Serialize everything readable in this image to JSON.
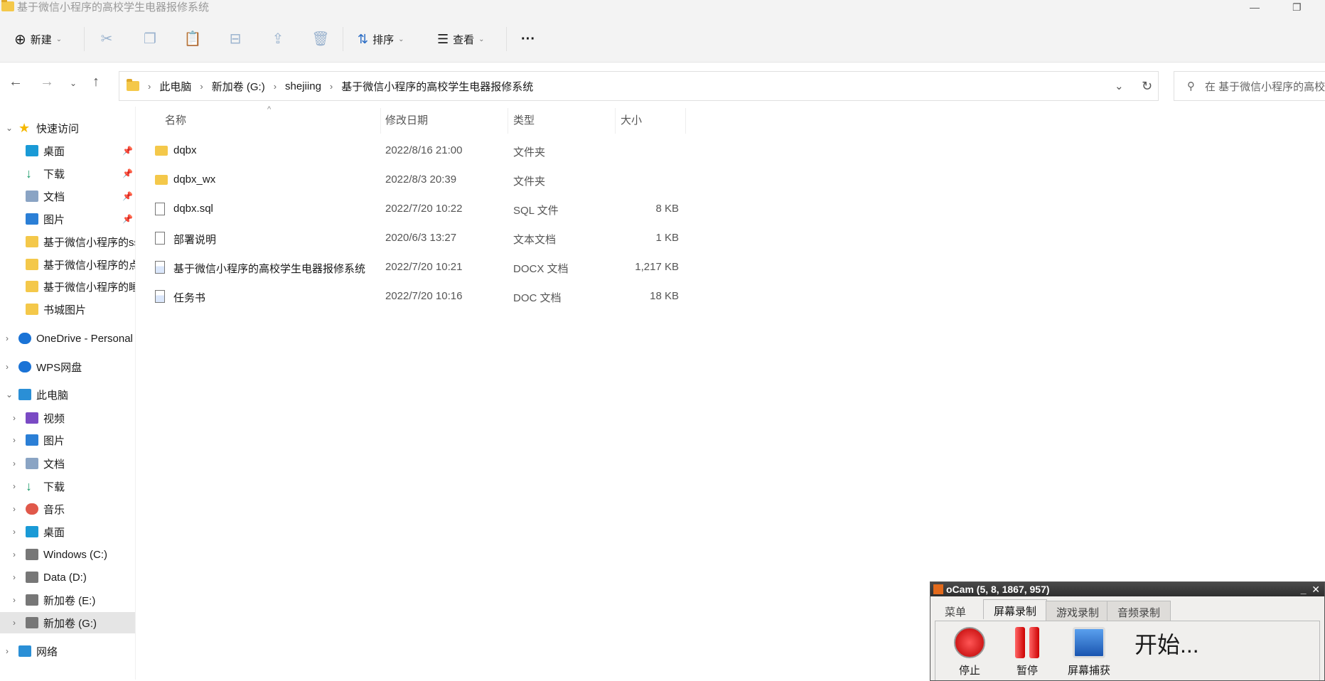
{
  "window": {
    "title": "基于微信小程序的高校学生电器报修系统"
  },
  "toolbar": {
    "new_label": "新建",
    "sort_label": "排序",
    "view_label": "查看",
    "more": "···"
  },
  "address": {
    "crumbs": [
      "此电脑",
      "新加卷 (G:)",
      "shejiing",
      "基于微信小程序的高校学生电器报修系统"
    ],
    "search_placeholder": "在 基于微信小程序的高校学生电器报修系统 中搜索"
  },
  "sidebar": {
    "items": [
      {
        "label": "快速访问",
        "level": 0,
        "icon": "star-icon",
        "chevron": "expanded"
      },
      {
        "label": "桌面",
        "level": 1,
        "icon": "desktop-icon",
        "pinned": true
      },
      {
        "label": "下载",
        "level": 1,
        "icon": "download-icon",
        "pinned": true
      },
      {
        "label": "文档",
        "level": 1,
        "icon": "documents-icon",
        "pinned": true
      },
      {
        "label": "图片",
        "level": 1,
        "icon": "pictures-icon",
        "pinned": true
      },
      {
        "label": "基于微信小程序的ssm",
        "level": 1,
        "icon": "folder-icon"
      },
      {
        "label": "基于微信小程序的点",
        "level": 1,
        "icon": "folder-icon"
      },
      {
        "label": "基于微信小程序的睡",
        "level": 1,
        "icon": "folder-icon"
      },
      {
        "label": "书城图片",
        "level": 1,
        "icon": "folder-icon"
      },
      {
        "label": "OneDrive - Personal",
        "level": 0,
        "icon": "cloud-icon",
        "chevron": "collapsed"
      },
      {
        "label": "WPS网盘",
        "level": 0,
        "icon": "cloud-icon",
        "chevron": "collapsed"
      },
      {
        "label": "此电脑",
        "level": 0,
        "icon": "computer-icon",
        "chevron": "expanded"
      },
      {
        "label": "视频",
        "level": 1,
        "icon": "videos-icon",
        "chevron": "collapsed"
      },
      {
        "label": "图片",
        "level": 1,
        "icon": "pictures-icon",
        "chevron": "collapsed"
      },
      {
        "label": "文档",
        "level": 1,
        "icon": "documents-icon",
        "chevron": "collapsed"
      },
      {
        "label": "下载",
        "level": 1,
        "icon": "download-icon",
        "chevron": "collapsed"
      },
      {
        "label": "音乐",
        "level": 1,
        "icon": "music-icon",
        "chevron": "collapsed"
      },
      {
        "label": "桌面",
        "level": 1,
        "icon": "desktop-icon",
        "chevron": "collapsed"
      },
      {
        "label": "Windows (C:)",
        "level": 1,
        "icon": "drive-icon",
        "chevron": "collapsed"
      },
      {
        "label": "Data (D:)",
        "level": 1,
        "icon": "drive-icon",
        "chevron": "collapsed"
      },
      {
        "label": "新加卷 (E:)",
        "level": 1,
        "icon": "drive-icon",
        "chevron": "collapsed"
      },
      {
        "label": "新加卷 (G:)",
        "level": 1,
        "icon": "drive-icon",
        "chevron": "collapsed",
        "selected": true
      },
      {
        "label": "网络",
        "level": 0,
        "icon": "network-icon",
        "chevron": "collapsed"
      }
    ]
  },
  "columns": {
    "name": "名称",
    "date": "修改日期",
    "type": "类型",
    "size": "大小"
  },
  "files": [
    {
      "name": "dqbx",
      "date": "2022/8/16 21:00",
      "type": "文件夹",
      "size": "",
      "icon": "folder-icon"
    },
    {
      "name": "dqbx_wx",
      "date": "2022/8/3 20:39",
      "type": "文件夹",
      "size": "",
      "icon": "folder-icon"
    },
    {
      "name": "dqbx.sql",
      "date": "2022/7/20 10:22",
      "type": "SQL 文件",
      "size": "8 KB",
      "icon": "file-icon"
    },
    {
      "name": "部署说明",
      "date": "2020/6/3 13:27",
      "type": "文本文档",
      "size": "1 KB",
      "icon": "text-file-icon"
    },
    {
      "name": "基于微信小程序的高校学生电器报修系统",
      "date": "2022/7/20 10:21",
      "type": "DOCX 文档",
      "size": "1,217 KB",
      "icon": "word-icon"
    },
    {
      "name": "任务书",
      "date": "2022/7/20 10:16",
      "type": "DOC 文档",
      "size": "18 KB",
      "icon": "word-icon"
    }
  ],
  "ocam": {
    "title": "oCam (5, 8, 1867, 957)",
    "tabs": [
      "菜单",
      "屏幕录制",
      "游戏录制",
      "音频录制"
    ],
    "active_tab": 1,
    "stop": "停止",
    "pause": "暂停",
    "capture": "屏幕捕获",
    "status": "开始..."
  }
}
